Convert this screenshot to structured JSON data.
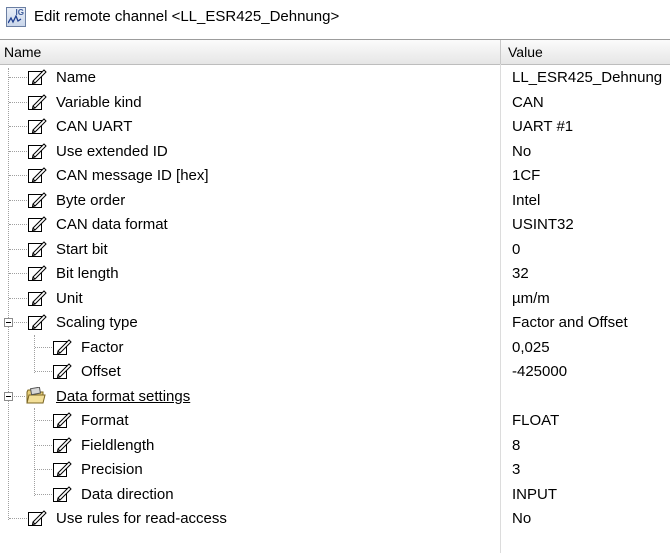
{
  "window": {
    "title": "Edit remote channel <LL_ESR425_Dehnung>",
    "icon": "app-icon"
  },
  "header": {
    "name_col": "Name",
    "value_col": "Value"
  },
  "rows": [
    {
      "label": "Name",
      "value": "LL_ESR425_Dehnung",
      "icon": "edit-icon"
    },
    {
      "label": "Variable kind",
      "value": "CAN",
      "icon": "edit-icon"
    },
    {
      "label": "CAN UART",
      "value": "UART #1",
      "icon": "edit-icon"
    },
    {
      "label": "Use extended ID",
      "value": "No",
      "icon": "edit-icon"
    },
    {
      "label": "CAN message ID [hex]",
      "value": "1CF",
      "icon": "edit-icon"
    },
    {
      "label": "Byte order",
      "value": "Intel",
      "icon": "edit-icon"
    },
    {
      "label": "CAN data format",
      "value": "USINT32",
      "icon": "edit-icon"
    },
    {
      "label": "Start bit",
      "value": "0",
      "icon": "edit-icon"
    },
    {
      "label": "Bit length",
      "value": "32",
      "icon": "edit-icon"
    },
    {
      "label": "Unit",
      "value": "µm/m",
      "icon": "edit-icon"
    },
    {
      "label": "Scaling type",
      "value": "Factor and Offset",
      "icon": "edit-icon",
      "expanded": true
    },
    {
      "label": "Factor",
      "value": "0,025",
      "icon": "edit-icon"
    },
    {
      "label": "Offset",
      "value": "-425000",
      "icon": "edit-icon"
    },
    {
      "label": "Data format settings",
      "value": "",
      "icon": "folder-icon",
      "expanded": true
    },
    {
      "label": "Format",
      "value": "FLOAT",
      "icon": "edit-icon"
    },
    {
      "label": "Fieldlength",
      "value": "8",
      "icon": "edit-icon"
    },
    {
      "label": "Precision",
      "value": "3",
      "icon": "edit-icon"
    },
    {
      "label": "Data direction",
      "value": "INPUT",
      "icon": "edit-icon"
    },
    {
      "label": "Use rules for read-access",
      "value": "No",
      "icon": "edit-icon"
    }
  ]
}
